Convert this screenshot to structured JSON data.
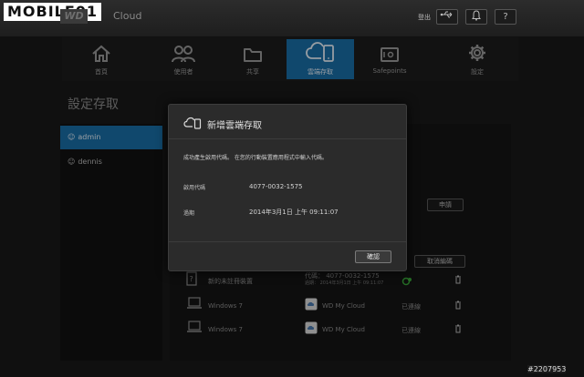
{
  "watermark": {
    "text": "MOBILE01"
  },
  "brand": {
    "cloud_text": "Cloud"
  },
  "topbar": {
    "logout_label": "登出",
    "usb_icon": "usb-icon",
    "bell_icon": "bell-icon",
    "help_label": "?"
  },
  "nav": {
    "items": [
      {
        "label": "首頁",
        "icon": "home-icon"
      },
      {
        "label": "使用者",
        "icon": "users-icon"
      },
      {
        "label": "共享",
        "icon": "folder-icon"
      },
      {
        "label": "雲端存取",
        "icon": "cloud-device-icon"
      },
      {
        "label": "Safepoints",
        "icon": "safe-icon"
      },
      {
        "label": "設定",
        "icon": "gear-icon"
      }
    ],
    "active_index": 3
  },
  "page": {
    "title": "設定存取"
  },
  "users": [
    {
      "name": "admin"
    },
    {
      "name": "dennis"
    }
  ],
  "content": {
    "apply_button": "申請",
    "cancel_pair_button": "取消編碼",
    "devices": [
      {
        "name": "新的未註冊裝置",
        "code_line": "代碼： 4077-0032-1575",
        "expiry_line": "過期： 2014年3月1日 上午 09:11:07",
        "status": ""
      },
      {
        "name": "Windows 7",
        "app": "WD My Cloud",
        "status": "已連線"
      },
      {
        "name": "Windows 7",
        "app": "WD My Cloud",
        "status": "已連線"
      }
    ]
  },
  "modal": {
    "title": "新增雲端存取",
    "message": "成功產生啟用代碼。 在您的行動裝置應用程式中輸入代碼。",
    "code_label": "啟用代碼",
    "code_value": "4077-0032-1575",
    "expiry_label": "過期",
    "expiry_value": "2014年3月1日 上午 09:11:07",
    "ok_button": "確認"
  },
  "copyright": {
    "text": "#2207953"
  },
  "colors": {
    "accent": "#1a6fa8",
    "background": "#1a1a1a"
  }
}
